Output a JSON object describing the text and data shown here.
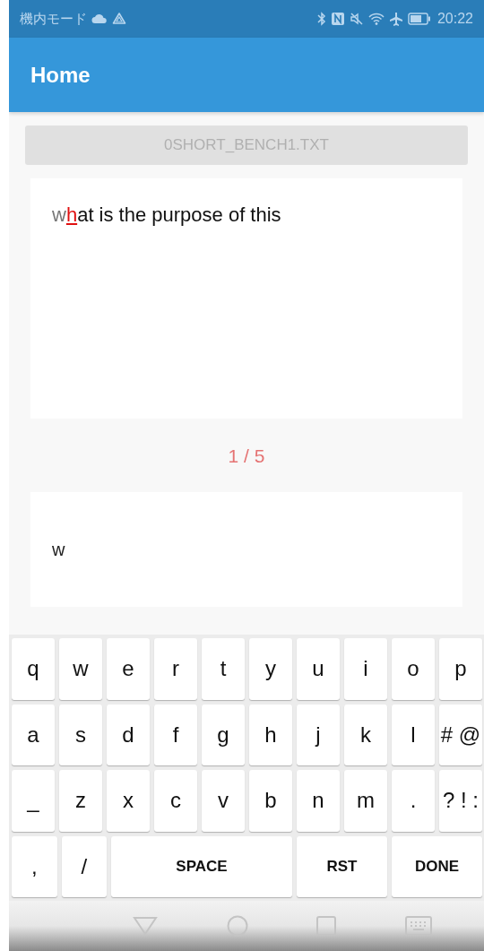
{
  "status_bar": {
    "mode": "機内モード",
    "time": "20:22"
  },
  "app_bar": {
    "title": "Home"
  },
  "file_button": {
    "label": "0SHORT_BENCH1.TXT"
  },
  "prompt": {
    "typed": "w",
    "current": "h",
    "remaining": "at is the purpose of this"
  },
  "counter": "1 / 5",
  "input": {
    "value": "w"
  },
  "keyboard": {
    "key_rows": [
      {
        "keys": [
          {
            "label": "q",
            "kind": "char"
          },
          {
            "label": "w",
            "kind": "char"
          },
          {
            "label": "e",
            "kind": "char"
          },
          {
            "label": "r",
            "kind": "char"
          },
          {
            "label": "t",
            "kind": "char"
          },
          {
            "label": "y",
            "kind": "char"
          },
          {
            "label": "u",
            "kind": "char"
          },
          {
            "label": "i",
            "kind": "char"
          },
          {
            "label": "o",
            "kind": "char"
          },
          {
            "label": "p",
            "kind": "char"
          }
        ]
      },
      {
        "keys": [
          {
            "label": "a",
            "kind": "char"
          },
          {
            "label": "s",
            "kind": "char"
          },
          {
            "label": "d",
            "kind": "char"
          },
          {
            "label": "f",
            "kind": "char"
          },
          {
            "label": "g",
            "kind": "char"
          },
          {
            "label": "h",
            "kind": "char"
          },
          {
            "label": "j",
            "kind": "char"
          },
          {
            "label": "k",
            "kind": "char"
          },
          {
            "label": "l",
            "kind": "char"
          },
          {
            "label": "# @",
            "kind": "char"
          }
        ]
      },
      {
        "keys": [
          {
            "label": "_",
            "kind": "char"
          },
          {
            "label": "z",
            "kind": "char"
          },
          {
            "label": "x",
            "kind": "char"
          },
          {
            "label": "c",
            "kind": "char"
          },
          {
            "label": "v",
            "kind": "char"
          },
          {
            "label": "b",
            "kind": "char"
          },
          {
            "label": "n",
            "kind": "char"
          },
          {
            "label": "m",
            "kind": "char"
          },
          {
            "label": ".",
            "kind": "char"
          },
          {
            "label": "? ! :",
            "kind": "char"
          }
        ]
      },
      {
        "keys": [
          {
            "label": ",",
            "kind": "char"
          },
          {
            "label": "/",
            "kind": "char"
          },
          {
            "label": "SPACE",
            "kind": "space"
          },
          {
            "label": "RST",
            "kind": "action"
          },
          {
            "label": "DONE",
            "kind": "action"
          }
        ]
      }
    ]
  }
}
